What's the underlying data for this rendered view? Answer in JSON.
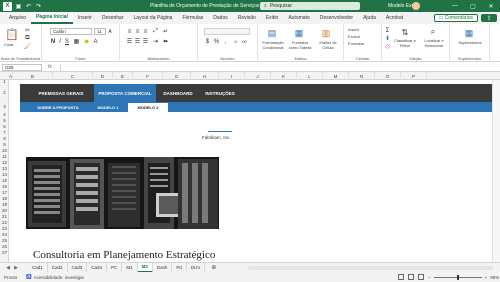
{
  "titlebar": {
    "logo": "X",
    "title": "Planilha de Orçamento de Prestação de Serviços Proposta Comercial...",
    "search_placeholder": "Pesquisar",
    "user": "Modelo Excel",
    "minimize": "—",
    "maximize": "▢",
    "close": "✕"
  },
  "ribbon_tabs": [
    "Arquivo",
    "Página Inicial",
    "Inserir",
    "Desenhar",
    "Layout da Página",
    "Fórmulas",
    "Dados",
    "Revisão",
    "Exibir",
    "Automate",
    "Desenvolvedor",
    "Ajuda",
    "Acrobat"
  ],
  "ribbon_active_tab": "Página Inicial",
  "comments_label": "Comentários",
  "ribbon": {
    "clipboard": {
      "paste": "Colar",
      "group": "Área de Transferência"
    },
    "font": {
      "name": "Calibri",
      "size": "11",
      "group": "Fonte"
    },
    "alignment": {
      "group": "Alinhamento"
    },
    "number": {
      "group": "Número"
    },
    "styles": {
      "conditional": "Formatação Condicional",
      "table": "Formatar como Tabela",
      "cell_styles": "Estilos de Célula",
      "group": "Estilos"
    },
    "cells": {
      "insert": "Inserir",
      "delete": "Excluir",
      "format": "Formatar",
      "group": "Células"
    },
    "editing": {
      "sort": "Classificar e Filtrar",
      "find": "Localizar e Selecionar",
      "group": "Edição"
    },
    "addins": {
      "label": "Suplementos",
      "group": "Suplementos"
    }
  },
  "formula_bar": {
    "cell_ref": "O25",
    "fx": "fx",
    "content": ""
  },
  "columns": [
    "A",
    "B",
    "C",
    "D",
    "E",
    "F",
    "G",
    "H",
    "I",
    "J",
    "K",
    "L",
    "M",
    "N",
    "O",
    "P"
  ],
  "rows": [
    "1",
    "2",
    "3",
    "4",
    "5",
    "6",
    "7",
    "8",
    "9",
    "10",
    "11",
    "12",
    "13",
    "14",
    "15",
    "16",
    "17",
    "18",
    "19",
    "20",
    "21",
    "22",
    "23",
    "24",
    "25",
    "26",
    "27"
  ],
  "nav": [
    "Premissas Gerais",
    "Proposta Comercial",
    "Dashboard",
    "Instruções"
  ],
  "nav_active": "Proposta Comercial",
  "subnav": [
    "Sobre a Proposta",
    "Modelo 1",
    "Modelo 2"
  ],
  "subnav_active": "Modelo 2",
  "company": "Fabrikam, Inc.",
  "main_title": "Consultoria em Planejamento Estratégico",
  "sheet_tabs": [
    "Cad1",
    "Cad2",
    "Cad3",
    "Cad4",
    "PC",
    "M1",
    "M2",
    "Dash",
    "Pd",
    "DUV"
  ],
  "sheet_active": "M2",
  "status": {
    "ready": "Pronto",
    "accessibility": "Acessibilidade: investigar",
    "zoom": "95%"
  },
  "colors": {
    "excel_green": "#217346",
    "nav_dark": "#3a3a3a",
    "nav_blue": "#2e75b6"
  }
}
